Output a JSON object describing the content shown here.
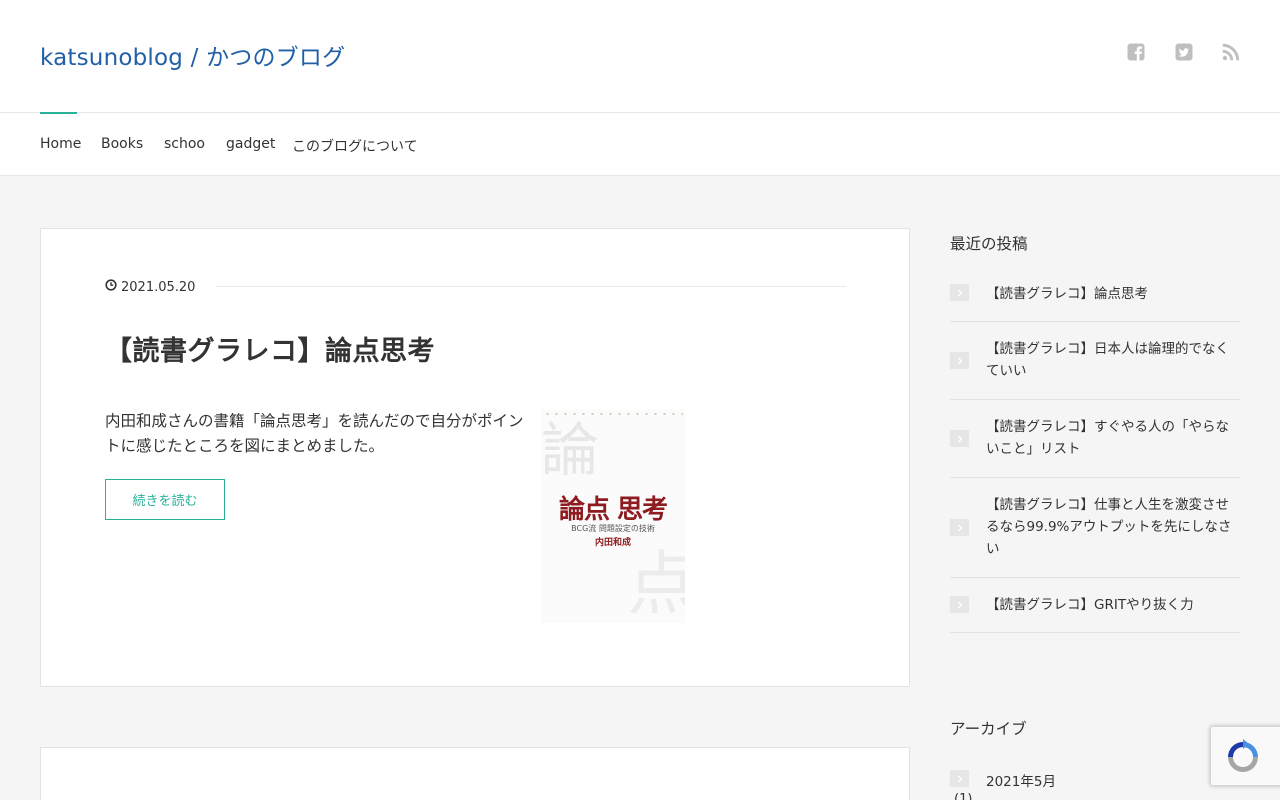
{
  "header": {
    "site_title": "katsunoblog / かつのブログ",
    "social_icons": [
      "facebook-icon",
      "twitter-icon",
      "rss-icon"
    ]
  },
  "nav": {
    "items": [
      {
        "label": "Home",
        "active": true
      },
      {
        "label": "Books"
      },
      {
        "label": "schoo"
      },
      {
        "label": "gadget"
      },
      {
        "label": "このブログについて"
      }
    ]
  },
  "post": {
    "date": "2021.05.20",
    "title": "【読書グラレコ】論点思考",
    "excerpt": "内田和成さんの書籍「論点思考」を読んだので自分がポイントに感じたところを図にまとめました。",
    "read_more": "続きを読む",
    "book_cover": {
      "title": "論点 思考",
      "subtitle": "BCG流 問題設定の技術",
      "author": "内田和成",
      "ghost_chars": [
        "論",
        "点"
      ]
    }
  },
  "sidebar": {
    "recent_heading": "最近の投稿",
    "recent_posts": [
      "【読書グラレコ】論点思考",
      "【読書グラレコ】日本人は論理的でなくていい",
      "【読書グラレコ】すぐやる人の「やらないこと」リスト",
      "【読書グラレコ】仕事と人生を激変させるなら99.9%アウトプットを先にしなさい",
      "【読書グラレコ】GRITやり抜く力"
    ],
    "archive_heading": "アーカイブ",
    "archives": [
      {
        "label": "2021年5月",
        "count": "(1)"
      }
    ]
  },
  "colors": {
    "site_title": "#2160a6",
    "accent": "#2bb09a",
    "book_red": "#8e1b1f",
    "background": "#f5f5f5"
  }
}
